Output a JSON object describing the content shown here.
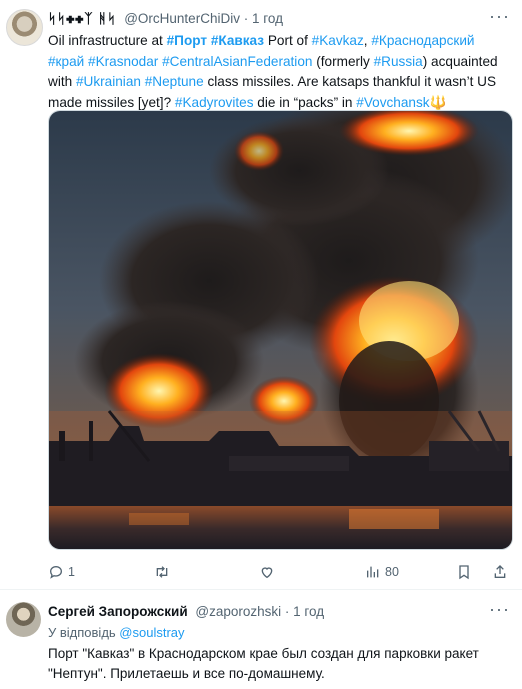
{
  "post": {
    "display_name": "ᛋᛋ✚✚ᛉ ᚻᛋ",
    "handle": "@OrcHunterChiDiv",
    "time": "1 год",
    "text_segments": [
      {
        "t": "Oil infrastructure at ",
        "k": "plain"
      },
      {
        "t": "#Порт",
        "k": "tag-bold"
      },
      {
        "t": " ",
        "k": "plain"
      },
      {
        "t": "#Кавказ",
        "k": "tag-bold"
      },
      {
        "t": " Port of ",
        "k": "plain"
      },
      {
        "t": "#Kavkaz",
        "k": "tag"
      },
      {
        "t": ", ",
        "k": "plain"
      },
      {
        "t": "#Краснодарский",
        "k": "tag"
      },
      {
        "t": " ",
        "k": "plain"
      },
      {
        "t": "#край",
        "k": "tag"
      },
      {
        "t": " ",
        "k": "plain"
      },
      {
        "t": "#Krasnodar",
        "k": "tag"
      },
      {
        "t": " ",
        "k": "plain"
      },
      {
        "t": "#CentralAsianFederation",
        "k": "tag"
      },
      {
        "t": " (formerly ",
        "k": "plain"
      },
      {
        "t": "#Russia",
        "k": "tag"
      },
      {
        "t": ") acquainted with ",
        "k": "plain"
      },
      {
        "t": "#Ukrainian",
        "k": "tag"
      },
      {
        "t": " ",
        "k": "plain"
      },
      {
        "t": "#Neptune",
        "k": "tag"
      },
      {
        "t": " class missiles. Are katsaps thankful it wasn’t US made missiles [yet]? ",
        "k": "plain"
      },
      {
        "t": "#Kadyrovites",
        "k": "tag"
      },
      {
        "t": " die in “packs” in ",
        "k": "plain"
      },
      {
        "t": "#Vovchansk",
        "k": "tag"
      },
      {
        "t": "🔱",
        "k": "emoji"
      }
    ],
    "media_alt": "Image",
    "actions": {
      "replies": "1",
      "retweets": "",
      "likes": "",
      "views": "80"
    }
  },
  "reply": {
    "display_name": "Сергей Запорожский",
    "handle": "@zaporozhski",
    "time": "1 год",
    "reply_prefix": "У відповідь ",
    "reply_to": "@soulstray",
    "text": "Порт \"Кавказ\" в Краснодарском крае был создан для парковки ракет \"Нептун\". Прилетаешь и все по-домашнему."
  },
  "colors": {
    "link": "#1d9bf0",
    "text": "#0f1419",
    "muted": "#536471"
  }
}
